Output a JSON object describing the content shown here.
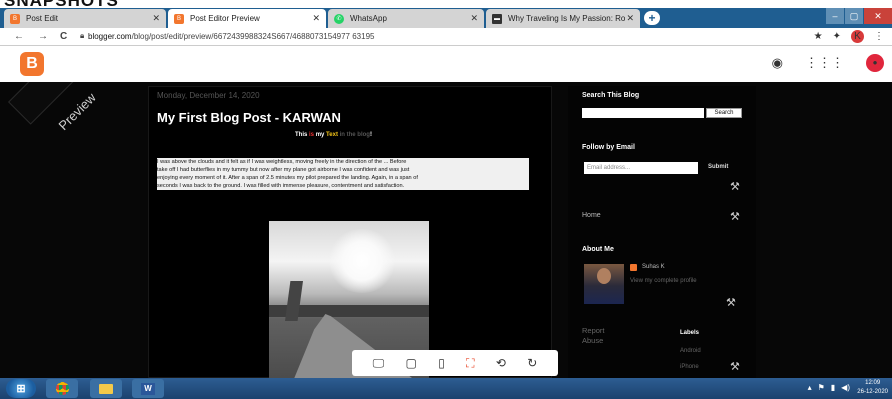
{
  "caption": {
    "text": "SNAPSHOTS"
  },
  "tabs": [
    {
      "label": "Post Edit",
      "icon": "blogger-icon",
      "color": "#f2762e"
    },
    {
      "label": "Post Editor Preview",
      "icon": "blogger-icon",
      "color": "#f2762e"
    },
    {
      "label": "WhatsApp",
      "icon": "whatsapp-icon",
      "color": "#25d366"
    },
    {
      "label": "Why Traveling Is My Passion: Ro",
      "icon": "page-icon",
      "color": "#333333"
    }
  ],
  "window": {
    "minimize": "–",
    "maximize": "▢",
    "close": "✕"
  },
  "address_bar": {
    "back": "←",
    "forward": "→",
    "reload": "C",
    "url_host": "blogger.com",
    "url_path": "/blog/post/edit/preview/6672439988324S667/4688073154977 63195"
  },
  "blogger_bar": {
    "logo_letter": "B",
    "avatar_letter": "•"
  },
  "preview": {
    "ribbon": "Preview",
    "date": "Monday, December 14, 2020",
    "title": "My First Blog Post - KARWAN",
    "subline": {
      "w1": "This",
      "r": "is",
      "w2": "my",
      "y": "Text",
      "g": "in the blog",
      "end": "!"
    },
    "body_lines": [
      "I was above the clouds and it felt as if I was weightless, moving freely in the direction of the ... Before",
      "take off I had butterflies in my tummy but now after my plane got airborne I was confident and was just",
      "enjoying every moment of it. After a span of 2.5 minutes my pilot prepared the landing. Again, in a span of",
      "seconds I was back to the ground. I was filled with immense pleasure, contentment and satisfaction."
    ]
  },
  "sidebar": {
    "search_heading": "Search This Blog",
    "search_button": "Search",
    "follow_heading": "Follow by Email",
    "email_placeholder": "Email address...",
    "submit_label": "Submit",
    "home_label": "Home",
    "about_heading": "About Me",
    "author_name": "Suhas K",
    "profile_link": "View my complete profile",
    "report_abuse": "Report Abuse",
    "labels_heading": "Labels",
    "label_1": "Android",
    "label_2": "iPhone"
  },
  "device_bar": {
    "icons": [
      "desktop-icon",
      "tablet-icon",
      "phone-icon",
      "fit-icon",
      "rotate-icon",
      "refresh-icon"
    ],
    "active": "fit-icon"
  },
  "taskbar": {
    "clock_time": "12:09",
    "clock_date": "26-12-2020"
  }
}
